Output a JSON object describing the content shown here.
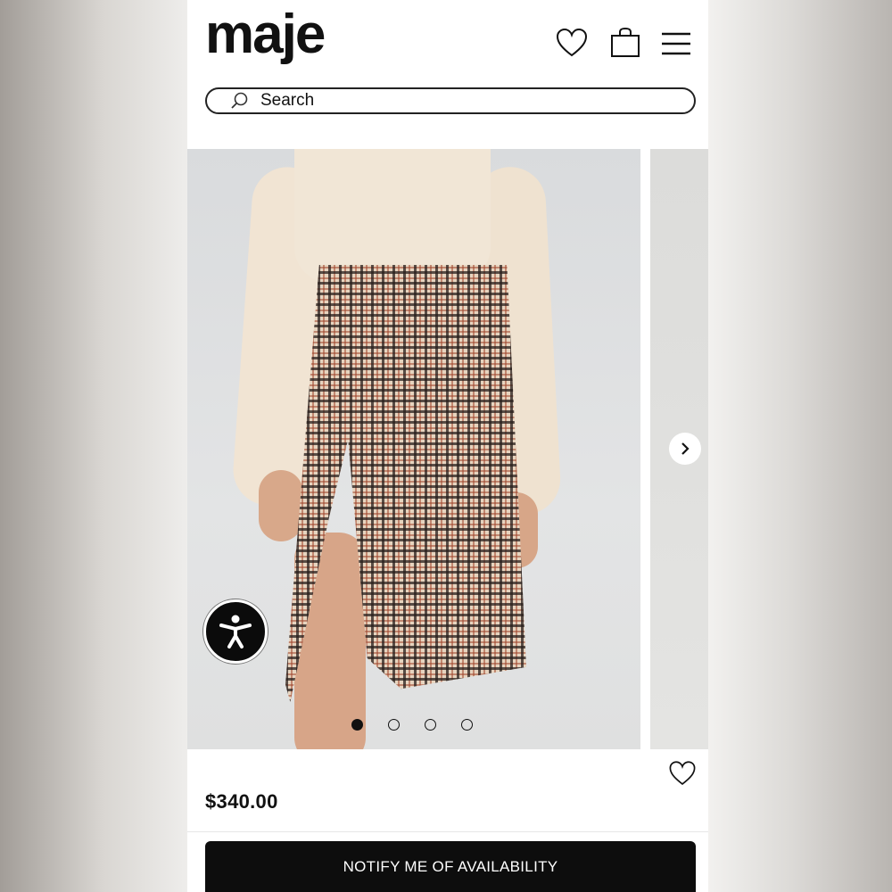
{
  "header": {
    "logo": "maje",
    "wishlist_icon": "heart-icon",
    "bag_icon": "shopping-bag-icon",
    "menu_icon": "hamburger-menu-icon"
  },
  "search": {
    "placeholder": "Search",
    "icon": "search-icon"
  },
  "gallery": {
    "image_count": 4,
    "active_index": 0,
    "next_icon": "chevron-right-icon"
  },
  "accessibility": {
    "icon": "accessibility-icon"
  },
  "product": {
    "price": "$340.00",
    "wishlist_icon": "heart-icon"
  },
  "cta": {
    "label": "NOTIFY ME OF AVAILABILITY"
  },
  "colors": {
    "text": "#111111",
    "button_bg": "#0d0d0d",
    "button_text": "#ffffff"
  }
}
